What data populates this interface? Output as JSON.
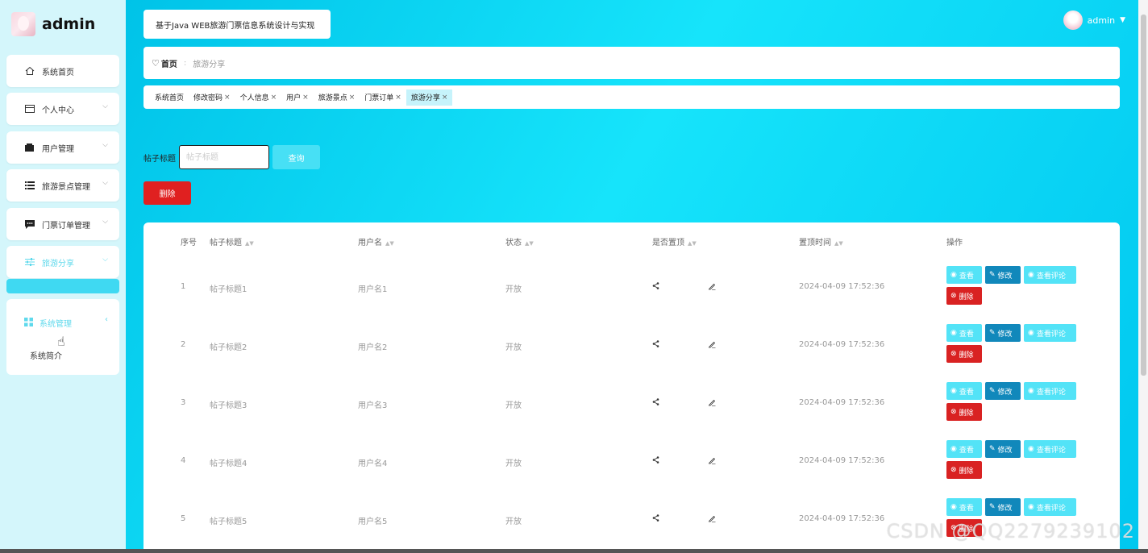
{
  "sidebar": {
    "logo_text": "admin",
    "items": [
      {
        "label": "系统首页",
        "icon": "home-icon"
      },
      {
        "label": "个人中心",
        "icon": "card-icon"
      },
      {
        "label": "用户管理",
        "icon": "wallet-icon"
      },
      {
        "label": "旅游景点管理",
        "icon": "list-icon"
      },
      {
        "label": "门票订单管理",
        "icon": "chat-icon"
      },
      {
        "label": "旅游分享",
        "icon": "sliders-icon"
      }
    ],
    "system": {
      "label": "系统管理",
      "sub": "系统简介"
    }
  },
  "header": {
    "app_title": "基于Java WEB旅游门票信息系统设计与实现",
    "username": "admin"
  },
  "breadcrumb": {
    "home": "首页",
    "current": "旅游分享"
  },
  "tabs": [
    {
      "label": "系统首页",
      "closable": false
    },
    {
      "label": "修改密码",
      "closable": true
    },
    {
      "label": "个人信息",
      "closable": true
    },
    {
      "label": "用户",
      "closable": true
    },
    {
      "label": "旅游景点",
      "closable": true
    },
    {
      "label": "门票订单",
      "closable": true
    },
    {
      "label": "旅游分享",
      "closable": true,
      "active": true
    }
  ],
  "search": {
    "label": "帖子标题",
    "placeholder": "帖子标题",
    "button": "查询"
  },
  "delete_button": "删除",
  "table": {
    "headers": [
      "序号",
      "帖子标题",
      "用户名",
      "状态",
      "是否置顶",
      "置顶时间",
      "操作"
    ],
    "rows": [
      {
        "no": "1",
        "title": "帖子标题1",
        "user": "用户名1",
        "status": "开放",
        "time": "2024-04-09 17:52:36"
      },
      {
        "no": "2",
        "title": "帖子标题2",
        "user": "用户名2",
        "status": "开放",
        "time": "2024-04-09 17:52:36"
      },
      {
        "no": "3",
        "title": "帖子标题3",
        "user": "用户名3",
        "status": "开放",
        "time": "2024-04-09 17:52:36"
      },
      {
        "no": "4",
        "title": "帖子标题4",
        "user": "用户名4",
        "status": "开放",
        "time": "2024-04-09 17:52:36"
      },
      {
        "no": "5",
        "title": "帖子标题5",
        "user": "用户名5",
        "status": "开放",
        "time": "2024-04-09 17:52:36"
      }
    ],
    "ops": {
      "view": "查看",
      "edit": "修改",
      "comments": "查看评论",
      "delete": "删除"
    }
  },
  "watermark": "CSDN @QQ2279239102",
  "colors": {
    "main_bg": "#16e4fb",
    "accent": "#47e0f5",
    "danger": "#e02020",
    "edit": "#1188bb"
  }
}
